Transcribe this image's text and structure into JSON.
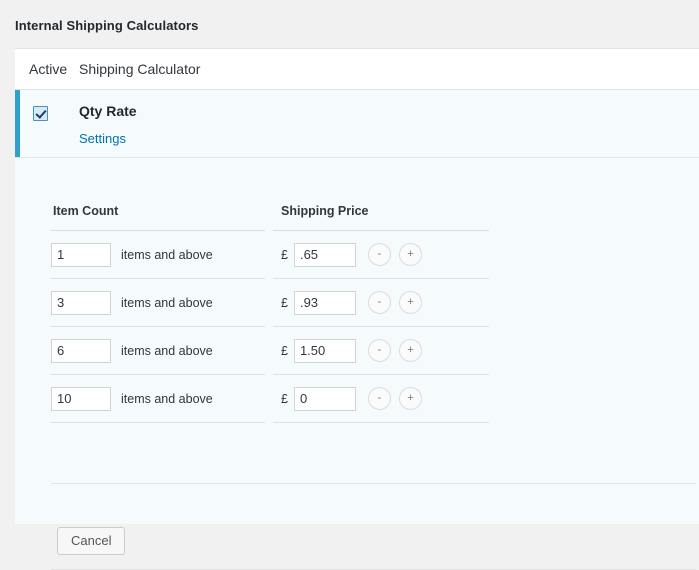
{
  "page": {
    "title": "Internal Shipping Calculators"
  },
  "list": {
    "headers": {
      "active": "Active",
      "calculator": "Shipping Calculator"
    },
    "calculator": {
      "name": "Qty Rate",
      "settings_link": "Settings",
      "active": true,
      "accent_color": "#2ea2cc"
    }
  },
  "settings": {
    "table": {
      "headers": {
        "item_count": "Item Count",
        "shipping_price": "Shipping Price"
      },
      "suffix_label": "items and above",
      "currency_symbol": "£",
      "decrement_label": "-",
      "increment_label": "+",
      "rows": [
        {
          "count": "1",
          "price": ".65"
        },
        {
          "count": "3",
          "price": ".93"
        },
        {
          "count": "6",
          "price": "1.50"
        },
        {
          "count": "10",
          "price": "0"
        }
      ]
    },
    "actions": {
      "cancel": "Cancel"
    }
  }
}
